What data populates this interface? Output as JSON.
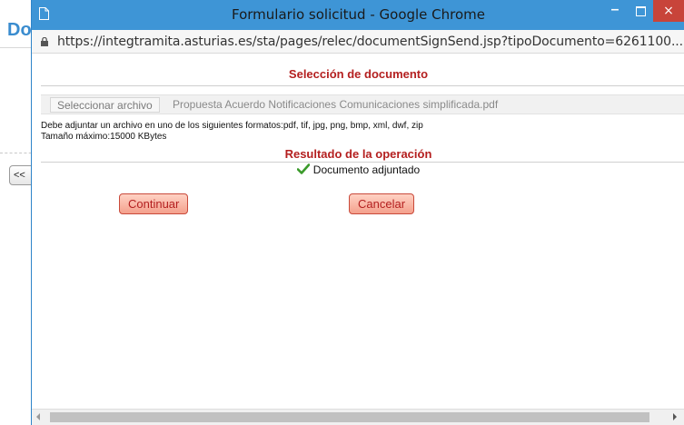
{
  "background": {
    "heading": "Do",
    "back_button": "<<"
  },
  "window": {
    "title": "Formulario solicitud - Google Chrome",
    "minimize": "–",
    "close": "×",
    "url": "https://integtramita.asturias.es/sta/pages/relec/documentSignSend.jsp?tipoDocumento=6261100..."
  },
  "form": {
    "selection_title": "Selección de documento",
    "file_button": "Seleccionar archivo",
    "file_name": "Propuesta Acuerdo Notificaciones Comunicaciones simplificada.pdf",
    "formats_note": "Debe adjuntar un archivo en uno de los siguientes formatos:pdf, tif, jpg, png, bmp, xml, dwf, zip",
    "max_size": "Tamaño máximo:15000 KBytes",
    "result_title": "Resultado de la operación",
    "result_message": "Documento adjuntado",
    "continue_button": "Continuar",
    "cancel_button": "Cancelar"
  },
  "colors": {
    "titlebar": "#3e95d6",
    "section_title": "#b41f1f",
    "button_fill": "#f4a08c",
    "check": "#3a9a2a"
  },
  "icons": [
    "page-icon",
    "lock-icon",
    "check-icon"
  ]
}
